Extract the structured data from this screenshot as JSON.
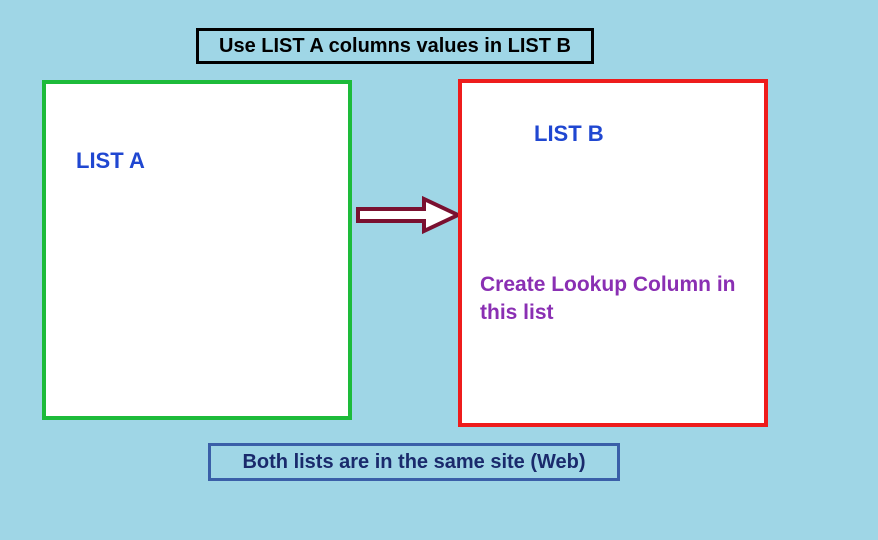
{
  "title": "Use LIST A columns values in LIST B",
  "box_a": {
    "label": "LIST A"
  },
  "box_b": {
    "label": "LIST B",
    "description": "Create Lookup Column in this list"
  },
  "footer": "Both lists are in the same site (Web)"
}
